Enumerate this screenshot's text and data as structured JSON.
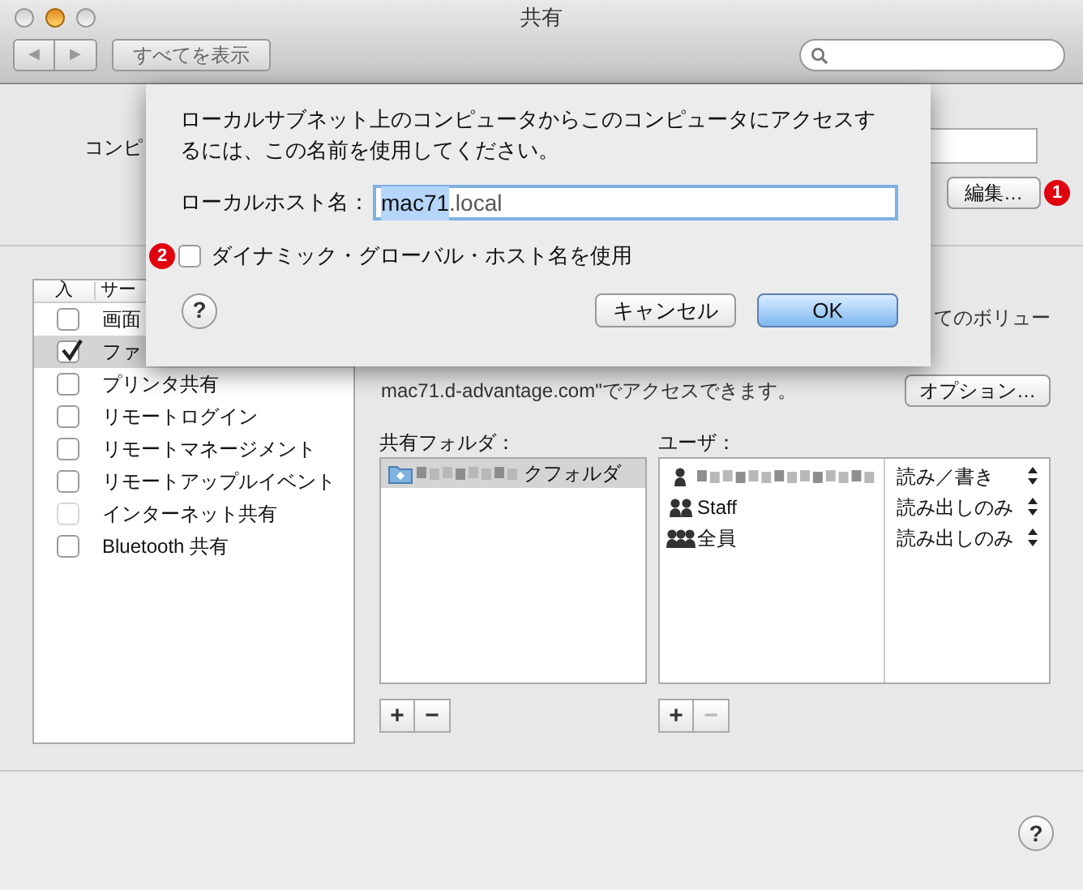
{
  "window": {
    "title": "共有"
  },
  "toolbar": {
    "back": "◀",
    "forward": "▶",
    "show_all": "すべてを表示"
  },
  "computer_name": {
    "label": "コンピ",
    "edit_button": "編集…",
    "badge": "1"
  },
  "services": {
    "columns": [
      "入",
      "サー"
    ],
    "items": [
      {
        "label": "画面",
        "checked": false,
        "selected": false,
        "disabled": false
      },
      {
        "label": "ファ",
        "checked": true,
        "selected": true,
        "disabled": false
      },
      {
        "label": "プリンタ共有",
        "checked": false,
        "selected": false,
        "disabled": false
      },
      {
        "label": "リモートログイン",
        "checked": false,
        "selected": false,
        "disabled": false
      },
      {
        "label": "リモートマネージメント",
        "checked": false,
        "selected": false,
        "disabled": false
      },
      {
        "label": "リモートアップルイベント",
        "checked": false,
        "selected": false,
        "disabled": false
      },
      {
        "label": "インターネット共有",
        "checked": false,
        "selected": false,
        "disabled": true
      },
      {
        "label": "Bluetooth 共有",
        "checked": false,
        "selected": false,
        "disabled": false
      }
    ]
  },
  "detail": {
    "text_1": "てのボリュー",
    "text_2": "mac71.d-advantage.com\"でアクセスできます。",
    "options_button": "オプション…"
  },
  "shared_folders": {
    "label": "共有フォルダ：",
    "items": [
      {
        "name": "クフォルダ",
        "selected": true
      }
    ],
    "add": "+",
    "remove": "−"
  },
  "users": {
    "label": "ユーザ：",
    "items": [
      {
        "kind": "person",
        "permission": "読み／書き"
      },
      {
        "kind": "group",
        "name": "Staff",
        "permission": "読み出しのみ"
      },
      {
        "kind": "everyone",
        "name": "全員",
        "permission": "読み出しのみ"
      }
    ],
    "add": "+",
    "remove": "−",
    "remove_disabled": true
  },
  "help": "?",
  "sheet": {
    "message": "ローカルサブネット上のコンピュータからこのコンピュータにアクセスするには、この名前を使用してください。",
    "hostname_label": "ローカルホスト名：",
    "hostname_selected": "mac71",
    "hostname_rest": ".local",
    "dynamic": {
      "label": "ダイナミック・グローバル・ホスト名を使用",
      "checked": false,
      "badge": "2"
    },
    "help": "?",
    "cancel": "キャンセル",
    "ok": "OK"
  }
}
